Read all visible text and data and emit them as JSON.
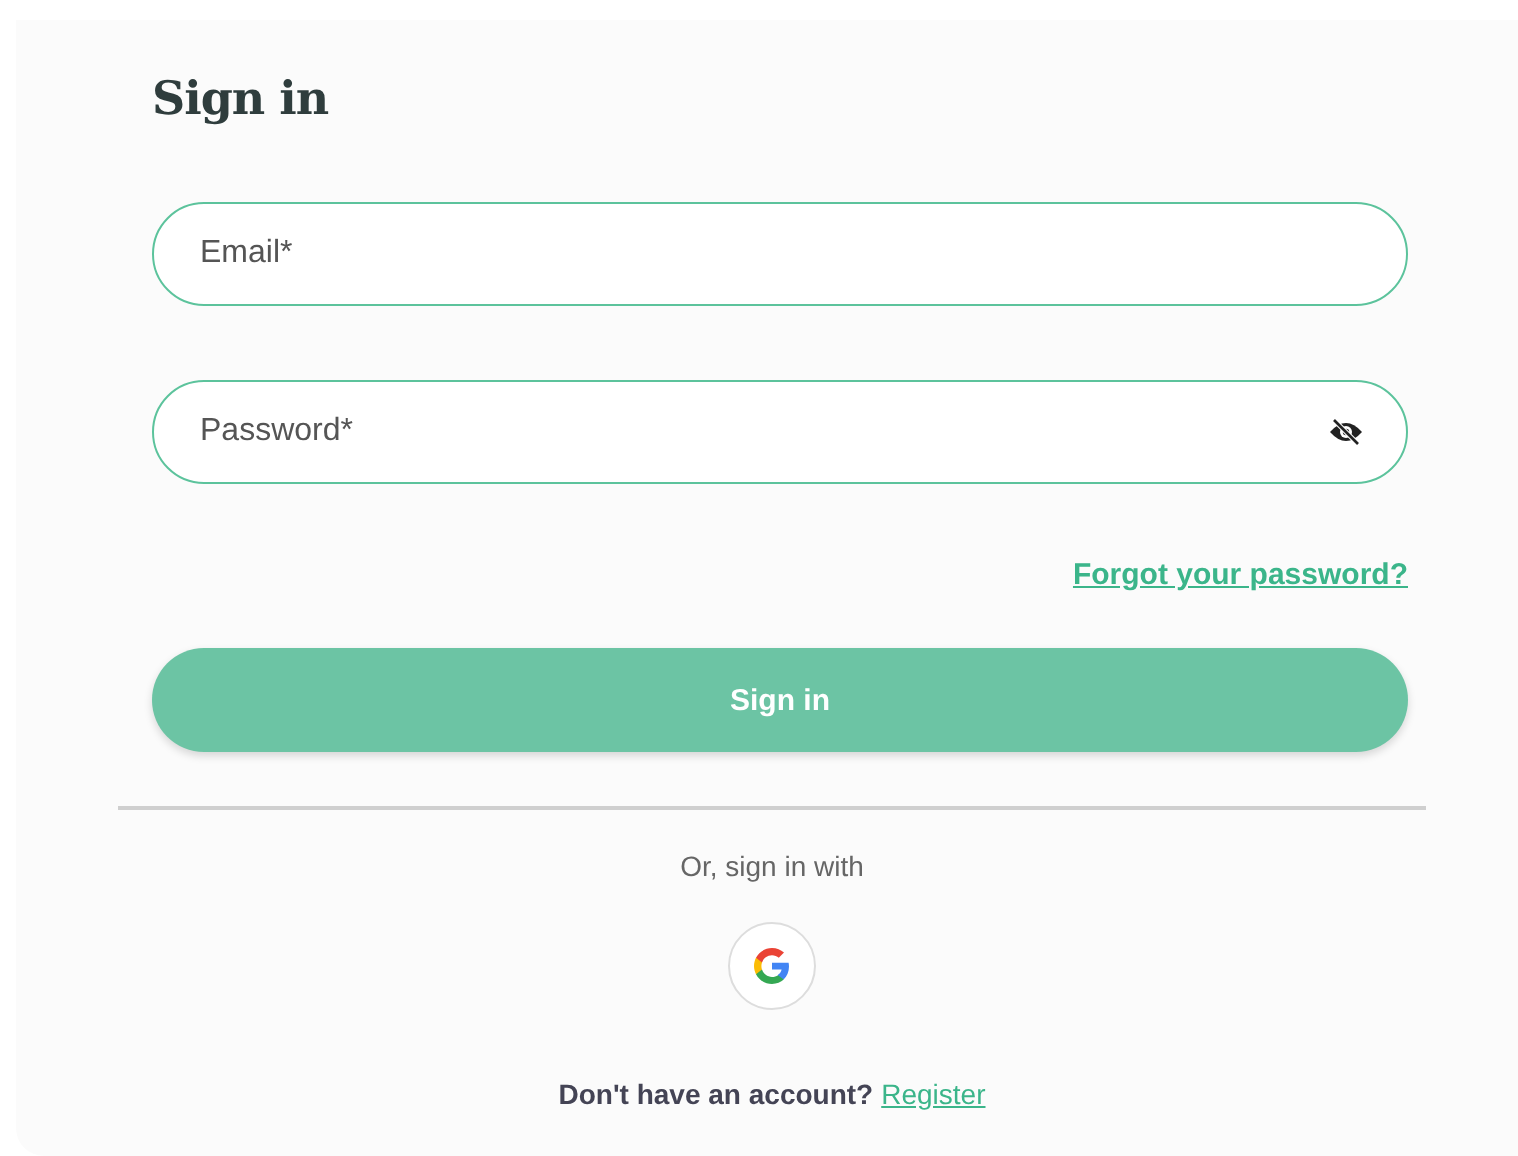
{
  "title": "Sign in",
  "fields": [
    {
      "kind": "email",
      "placeholder": "Email*"
    },
    {
      "kind": "password",
      "placeholder": "Password*"
    }
  ],
  "forgot_link": "Forgot your password?",
  "submit_button": "Sign in",
  "alt_signin_label": "Or, sign in with",
  "providers": [
    {
      "kind": "google"
    }
  ],
  "register_prompt": {
    "text": "Don't have an account?",
    "link": "Register"
  }
}
